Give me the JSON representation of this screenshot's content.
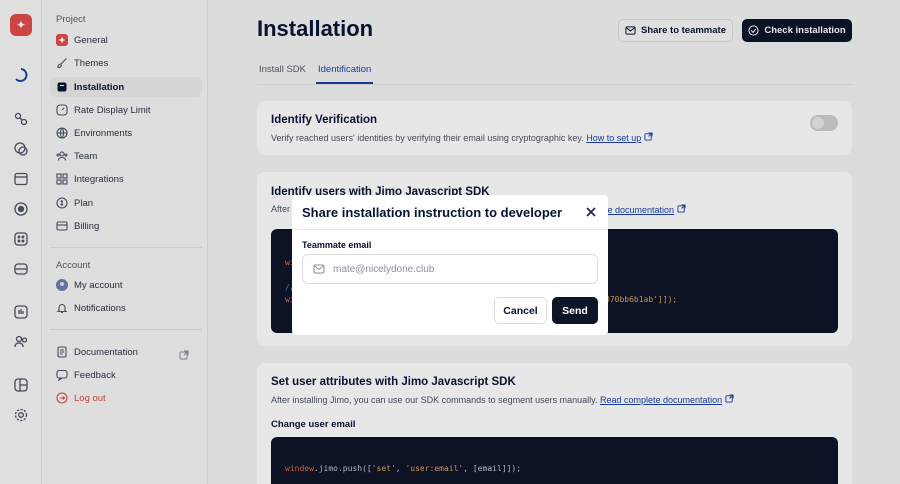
{
  "rail": {
    "logo_glyph": "✦",
    "icons": [
      "loading-icon",
      "users-icon",
      "messages-icon",
      "browser-icon",
      "target-icon",
      "grid-icon",
      "inbox-icon",
      "pulse-icon",
      "people-icon",
      "layout-icon",
      "settings-icon"
    ]
  },
  "nav": {
    "project_label": "Project",
    "account_label": "Account",
    "items": [
      {
        "label": "General",
        "icon": "brand-icon"
      },
      {
        "label": "Themes",
        "icon": "brush-icon"
      },
      {
        "label": "Installation",
        "icon": "box-icon"
      },
      {
        "label": "Rate Display Limit",
        "icon": "gauge-icon"
      },
      {
        "label": "Environments",
        "icon": "globe-icon"
      },
      {
        "label": "Team",
        "icon": "team-icon"
      },
      {
        "label": "Integrations",
        "icon": "grid-icon"
      },
      {
        "label": "Plan",
        "icon": "coin-icon"
      },
      {
        "label": "Billing",
        "icon": "card-icon"
      }
    ],
    "account_items": [
      {
        "label": "My account",
        "icon": "avatar-icon"
      },
      {
        "label": "Notifications",
        "icon": "bell-icon"
      }
    ],
    "footer_items": [
      {
        "label": "Documentation",
        "icon": "doc-icon"
      },
      {
        "label": "Feedback",
        "icon": "chat-icon"
      },
      {
        "label": "Log out",
        "icon": "logout-icon"
      }
    ]
  },
  "header": {
    "title": "Installation",
    "share_label": "Share to teammate",
    "check_label": "Check installation"
  },
  "tabs": [
    {
      "label": "Install SDK",
      "active": false
    },
    {
      "label": "Identification",
      "active": true
    }
  ],
  "cards": {
    "verify": {
      "title": "Identify Verification",
      "desc": "Verify reached users' identities by verifying their email using cryptographic key.",
      "link": "How to set up",
      "toggle_on": false
    },
    "identify": {
      "title": "Identify users with Jimo Javascript SDK",
      "desc_start": "After",
      "link_end": "te documentation",
      "code_l1": "wi",
      "code_l2": "//",
      "code_l3_start": "wi",
      "code_l3_end": "070bb6b1ab']]);"
    },
    "attributes": {
      "title": "Set user attributes with Jimo Javascript SDK",
      "desc": "After installing Jimo, you can use our SDK commands to segment users manually.",
      "link": "Read complete documentation",
      "subtitle": "Change user email",
      "code_window": "window",
      "code_rest": ".jimo.push([",
      "code_s1": "'set'",
      "code_sep": ", ",
      "code_s2": "'user:email'",
      "code_tail": ", [email]]);"
    }
  },
  "modal": {
    "title": "Share installation instruction to developer",
    "email_label": "Teammate email",
    "email_placeholder": "mate@nicelydone.club",
    "cancel_label": "Cancel",
    "send_label": "Send"
  },
  "colors": {
    "accent": "#1a3fa8",
    "dark": "#0c1428",
    "brand_red": "#e24a4a",
    "logout_red": "#d64a3a"
  }
}
